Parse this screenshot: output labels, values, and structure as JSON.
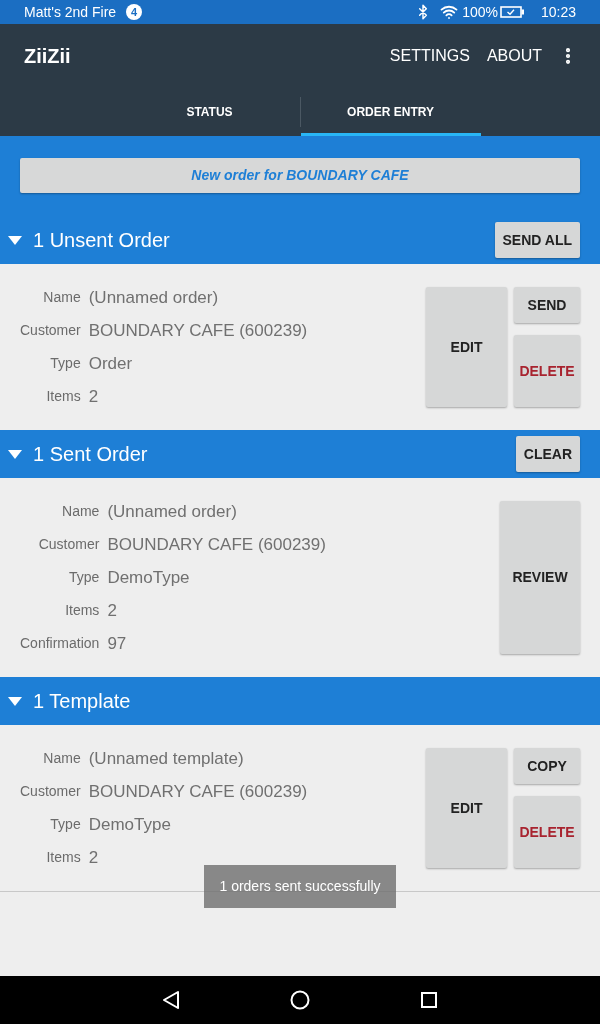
{
  "status_bar": {
    "device_name": "Matt's 2nd Fire",
    "notification_count": "4",
    "battery": "100%",
    "time": "10:23"
  },
  "app_bar": {
    "title": "ZiiZii",
    "actions": [
      "SETTINGS",
      "ABOUT"
    ]
  },
  "tabs": [
    {
      "label": "STATUS",
      "selected": false
    },
    {
      "label": "ORDER ENTRY",
      "selected": true
    }
  ],
  "new_order_button": "New order for BOUNDARY CAFE",
  "sections": [
    {
      "title": "1 Unsent Order",
      "expanded": true,
      "header_button": "SEND ALL",
      "cards": [
        {
          "fields": [
            {
              "label": "Name",
              "value": "(Unnamed order)"
            },
            {
              "label": "Customer",
              "value": "BOUNDARY CAFE (600239)"
            },
            {
              "label": "Type",
              "value": "Order"
            },
            {
              "label": "Items",
              "value": "2"
            }
          ],
          "buttons": [
            {
              "label": "EDIT",
              "danger": false
            },
            {
              "label": "SEND",
              "danger": false
            },
            {
              "label": "DELETE",
              "danger": true
            }
          ]
        }
      ]
    },
    {
      "title": "1 Sent Order",
      "expanded": true,
      "header_button": "CLEAR",
      "cards": [
        {
          "fields": [
            {
              "label": "Name",
              "value": "(Unnamed order)"
            },
            {
              "label": "Customer",
              "value": "BOUNDARY CAFE (600239)"
            },
            {
              "label": "Type",
              "value": "DemoType"
            },
            {
              "label": "Items",
              "value": "2"
            },
            {
              "label": "Confirmation",
              "value": "97"
            }
          ],
          "buttons": [
            {
              "label": "REVIEW",
              "danger": false
            }
          ]
        }
      ]
    },
    {
      "title": "1 Template",
      "expanded": true,
      "cards": [
        {
          "fields": [
            {
              "label": "Name",
              "value": "(Unnamed template)"
            },
            {
              "label": "Customer",
              "value": "BOUNDARY CAFE (600239)"
            },
            {
              "label": "Type",
              "value": "DemoType"
            },
            {
              "label": "Items",
              "value": "2"
            }
          ],
          "buttons": [
            {
              "label": "EDIT",
              "danger": false
            },
            {
              "label": "COPY",
              "danger": false
            },
            {
              "label": "DELETE",
              "danger": true
            }
          ]
        }
      ]
    }
  ],
  "toast": "1 orders sent successfully"
}
